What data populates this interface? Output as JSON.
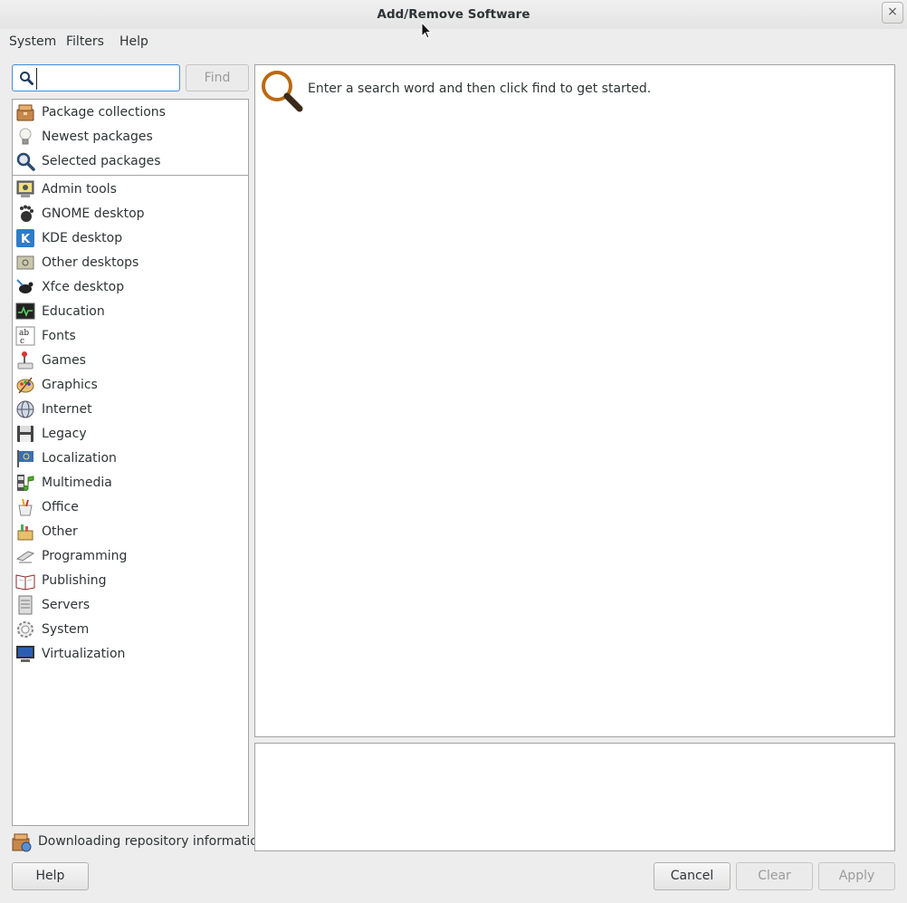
{
  "window": {
    "title": "Add/Remove Software",
    "close_symbol": "×"
  },
  "menu": [
    "System",
    "Filters",
    "Help"
  ],
  "search": {
    "value": "",
    "placeholder": "",
    "find_label": "Find"
  },
  "groups": [
    {
      "label": "Package collections",
      "icon": "package-collections-icon"
    },
    {
      "label": "Newest packages",
      "icon": "lightbulb-icon"
    },
    {
      "label": "Selected packages",
      "icon": "magnifier-icon"
    }
  ],
  "categories": [
    {
      "label": "Admin tools",
      "icon": "admin-tools-icon"
    },
    {
      "label": "GNOME desktop",
      "icon": "gnome-foot-icon"
    },
    {
      "label": "KDE desktop",
      "icon": "kde-icon"
    },
    {
      "label": "Other desktops",
      "icon": "other-desktops-icon"
    },
    {
      "label": "Xfce desktop",
      "icon": "xfce-mouse-icon"
    },
    {
      "label": "Education",
      "icon": "education-icon"
    },
    {
      "label": "Fonts",
      "icon": "fonts-icon"
    },
    {
      "label": "Games",
      "icon": "games-joystick-icon"
    },
    {
      "label": "Graphics",
      "icon": "graphics-palette-icon"
    },
    {
      "label": "Internet",
      "icon": "internet-globe-icon"
    },
    {
      "label": "Legacy",
      "icon": "legacy-floppy-icon"
    },
    {
      "label": "Localization",
      "icon": "localization-flag-icon"
    },
    {
      "label": "Multimedia",
      "icon": "multimedia-icon"
    },
    {
      "label": "Office",
      "icon": "office-icon"
    },
    {
      "label": "Other",
      "icon": "other-box-icon"
    },
    {
      "label": "Programming",
      "icon": "programming-icon"
    },
    {
      "label": "Publishing",
      "icon": "publishing-book-icon"
    },
    {
      "label": "Servers",
      "icon": "servers-icon"
    },
    {
      "label": "System",
      "icon": "system-gear-icon"
    },
    {
      "label": "Virtualization",
      "icon": "virtualization-monitor-icon"
    }
  ],
  "status": {
    "text": "Downloading repository information"
  },
  "results": {
    "message": "Enter a search word and then click find to get started."
  },
  "buttons": {
    "help": "Help",
    "cancel": "Cancel",
    "clear": "Clear",
    "apply": "Apply"
  },
  "colors": {
    "focus": "#4a90d9",
    "border": "#a3a3a3",
    "background": "#ededed"
  }
}
